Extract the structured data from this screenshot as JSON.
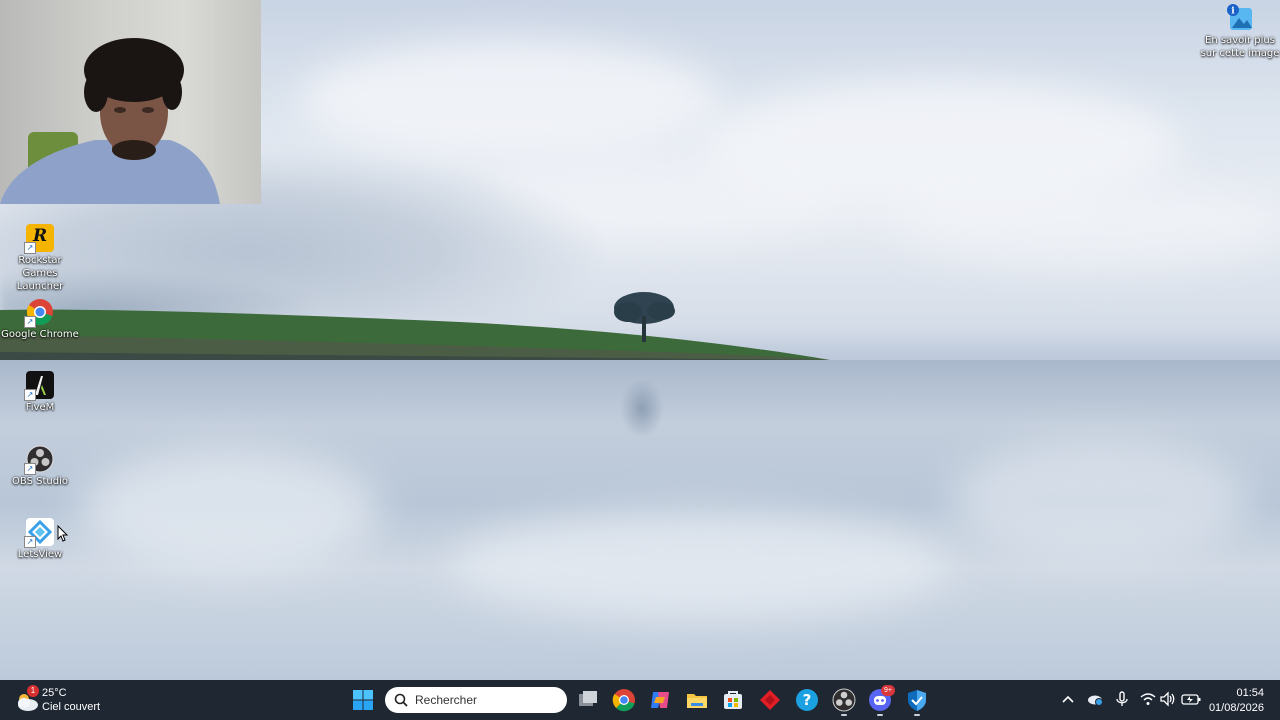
{
  "desktop": {
    "learn_more": "En savoir plus sur cette image",
    "icons": [
      {
        "label": "Rockstar Games Launcher",
        "icon": "rockstar-icon",
        "color": "#f5b400"
      },
      {
        "label": "Google Chrome",
        "icon": "chrome-icon",
        "color": "#4285f4"
      },
      {
        "label": "FiveM",
        "icon": "fivem-icon",
        "color": "#111111"
      },
      {
        "label": "OBS Studio",
        "icon": "obs-icon",
        "color": "#302e31"
      },
      {
        "label": "LetsView",
        "icon": "letsview-icon",
        "color": "#3aa0e8"
      }
    ]
  },
  "taskbar": {
    "weather": {
      "temp": "25°C",
      "condition": "Ciel couvert",
      "badge": "1"
    },
    "search_placeholder": "Rechercher",
    "apps": [
      "start-icon",
      "task-view-icon",
      "chrome-icon",
      "copilot-icon",
      "file-explorer-icon",
      "store-icon",
      "app-red-icon",
      "help-icon",
      "obs-icon",
      "discord-icon",
      "defender-icon"
    ],
    "discord_badge": "9+",
    "clock": {
      "time": "01:54",
      "date": "01/08/2026"
    },
    "colors": {
      "bar": "#1f2733",
      "accent": "#0078d4"
    }
  }
}
